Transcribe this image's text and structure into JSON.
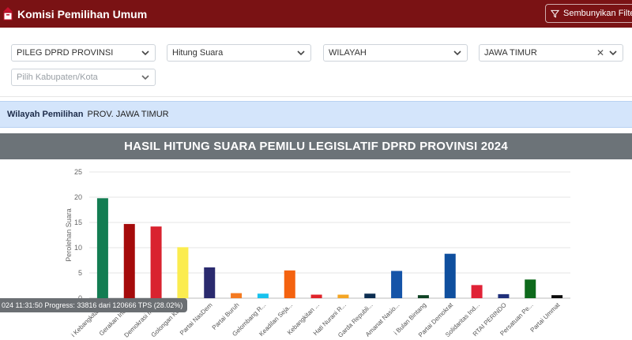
{
  "app": {
    "title": "Komisi Pemilihan Umum",
    "filter_button": "Sembunyikan Filter"
  },
  "filters": {
    "jenis": "PILEG DPRD PROVINSI",
    "mode": "Hitung Suara",
    "tingkat": "WILAYAH",
    "provinsi": "JAWA TIMUR",
    "kabupaten_placeholder": "Pilih Kabupaten/Kota"
  },
  "wilayah": {
    "label": "Wilayah Pemilihan",
    "value": "PROV. JAWA TIMUR"
  },
  "chart_title": "HASIL HITUNG SUARA PEMILU LEGISLATIF DPRD PROVINSI 2024",
  "progress": "024 11:31:50 Progress: 33816 dari 120666 TPS (28.02%)",
  "icons": {
    "logo": "kpu-logo-icon",
    "filter": "filter-icon",
    "chevron": "chevron-down-icon",
    "clear": "close-icon"
  },
  "colors": {
    "brand": "#7a1214",
    "header_gray": "#6c7378",
    "info_bg": "#d4e5fb"
  },
  "chart_data": {
    "type": "bar",
    "ylabel": "Perolehan Suara",
    "ylim": [
      0,
      25
    ],
    "yticks": [
      0,
      5,
      10,
      15,
      20,
      25
    ],
    "grid": true,
    "categories": [
      "i Kebangkitan ...",
      "Gerakan Indo...",
      "Demokrasi Ind...",
      "Golongan Karya",
      "Partai NasDem",
      "Partai Buruh",
      "Gelombang R...",
      "Keadilan Seja...",
      "Kebangkitan ...",
      "Hati Nurani R...",
      "Garda Republi...",
      "Amanat Nasio...",
      "i Bulan Bintang",
      "Partai Demokrat",
      "Solidaritas Ind...",
      "RTAI PERINDO",
      "Persatuan Pe...",
      "Partai Ummat"
    ],
    "values": [
      19.8,
      14.7,
      14.2,
      10.1,
      6.1,
      1.0,
      0.9,
      5.5,
      0.7,
      0.7,
      0.9,
      5.4,
      0.6,
      8.8,
      2.6,
      0.8,
      3.7,
      0.6
    ],
    "colors": [
      "#137d52",
      "#a50b0b",
      "#d9232f",
      "#fbec4f",
      "#2a2a6e",
      "#f47a21",
      "#18c2ee",
      "#f4620f",
      "#e0242b",
      "#f4a524",
      "#0c2e52",
      "#1554a8",
      "#0e4224",
      "#0f4f9e",
      "#e02236",
      "#20307a",
      "#0e6a1c",
      "#0c0c0c"
    ]
  }
}
